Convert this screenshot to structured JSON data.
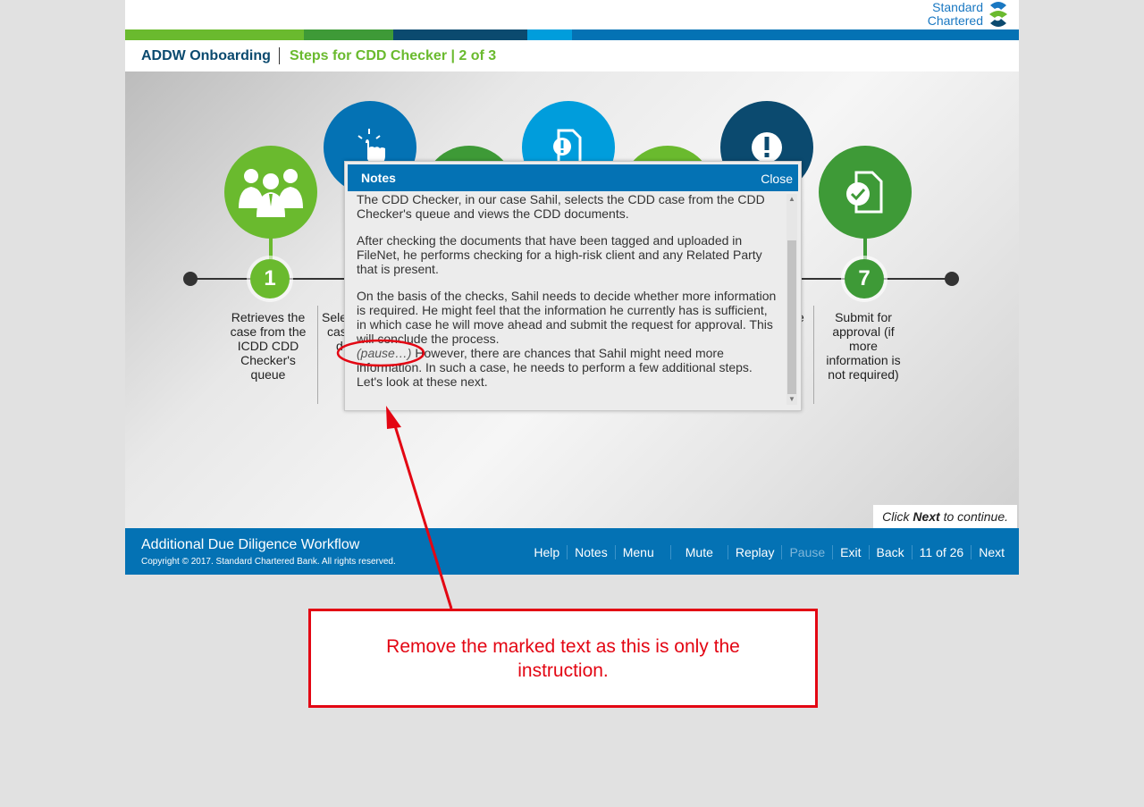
{
  "logo": {
    "line1": "Standard",
    "line2": "Chartered"
  },
  "brand_colors": {
    "blue": "#0472b4",
    "green": "#6aba2e",
    "dark_green": "#3e9a37",
    "navy": "#0b4a6f",
    "light_blue": "#009ddc"
  },
  "header": {
    "course_title": "ADDW Onboarding",
    "step_title": "Steps for CDD Checker | 2 of 3"
  },
  "steps": [
    {
      "number": "1",
      "text_lines": [
        "Retrieves the",
        "case from the",
        "ICDD CDD",
        "Checker's",
        "queue"
      ],
      "icon": "team-icon"
    },
    {
      "number": "7",
      "text_lines": [
        "Submit for",
        "approval (if",
        "more",
        "information is",
        "not required)"
      ],
      "icon": "document-check-icon"
    }
  ],
  "partial_step_text": {
    "left": [
      "Sele",
      "cas",
      "d"
    ],
    "right": [
      "e"
    ]
  },
  "notes": {
    "title": "Notes",
    "close": "Close",
    "p1": "The CDD Checker, in our case Sahil, selects the CDD case from the CDD Checker's queue and views the CDD documents.",
    "p2": "After checking the documents that have been tagged and uploaded in FileNet, he performs checking for a high-risk client and any Related Party that is present.",
    "p3": "On the basis of the checks, Sahil needs to decide whether more information is required. He might feel that the information he currently has is sufficient, in which case he will move ahead and submit the request for approval. This will conclude the process.",
    "pause_marker": "(pause…)",
    "p4": " However, there are chances that Sahil might need more information. In such a case, he needs to perform a few additional steps. Let's look at these next."
  },
  "click_next": {
    "prefix": "Click ",
    "bold": "Next",
    "suffix": " to continue."
  },
  "footer": {
    "title": "Additional Due Diligence Workflow",
    "copyright": "Copyright © 2017. Standard Chartered Bank. All rights reserved.",
    "nav": {
      "help": "Help",
      "notes": "Notes",
      "menu": "Menu",
      "mute": "Mute",
      "replay": "Replay",
      "pause": "Pause",
      "exit": "Exit",
      "back": "Back",
      "page": "11 of 26",
      "next": "Next"
    }
  },
  "annotation": {
    "callout_text": "Remove the marked text as this is only the instruction.",
    "color": "#e30613"
  }
}
